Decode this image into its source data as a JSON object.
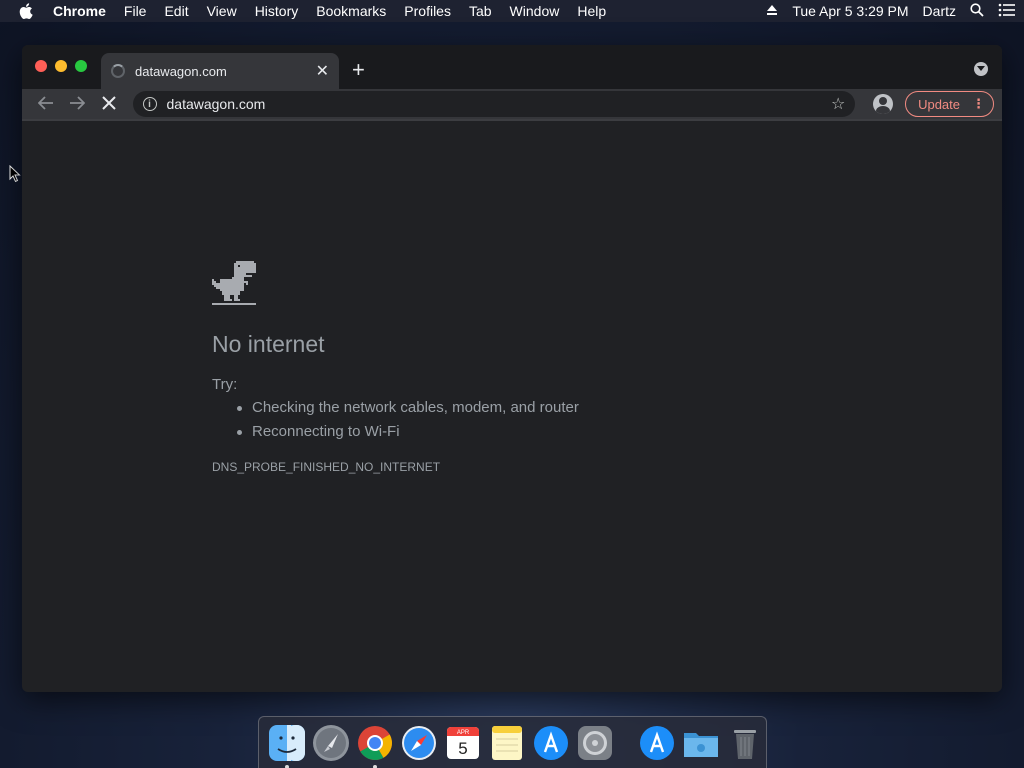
{
  "menubar": {
    "apple_icon": "apple-icon",
    "app_name": "Chrome",
    "items": [
      "File",
      "Edit",
      "View",
      "History",
      "Bookmarks",
      "Profiles",
      "Tab",
      "Window",
      "Help"
    ],
    "datetime": "Tue Apr 5  3:29 PM",
    "user": "Dartz"
  },
  "browser": {
    "tab_title": "datawagon.com",
    "url": "datawagon.com",
    "update_label": "Update"
  },
  "error_page": {
    "title": "No internet",
    "try_label": "Try:",
    "suggestions": [
      "Checking the network cables, modem, and router",
      "Reconnecting to Wi-Fi"
    ],
    "error_code": "DNS_PROBE_FINISHED_NO_INTERNET"
  },
  "dock": {
    "apps": [
      "Finder",
      "Launchpad",
      "Chrome",
      "Safari",
      "Calendar",
      "Notes",
      "App Store",
      "System Preferences",
      "App Store",
      "Downloads",
      "Trash"
    ],
    "calendar_month": "APR",
    "calendar_day": "5"
  },
  "colors": {
    "accent_update": "#f28b82",
    "page_bg": "#202124",
    "text_muted": "#9aa0a6"
  }
}
